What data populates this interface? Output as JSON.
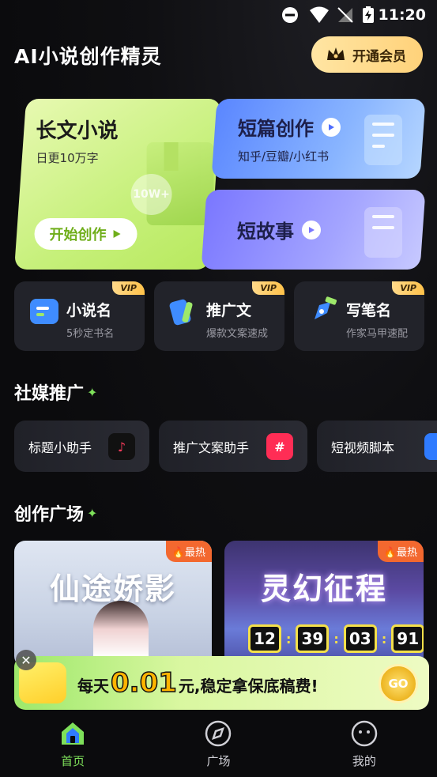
{
  "status": {
    "time": "11:20"
  },
  "header": {
    "title": "AI小说创作精灵",
    "vip_button": "开通会员"
  },
  "cards": {
    "long": {
      "title": "长文小说",
      "subtitle": "日更10万字",
      "badge": "10W+",
      "button": "开始创作"
    },
    "short": {
      "title": "短篇创作",
      "subtitle": "知乎/豆瓣/小红书"
    },
    "story": {
      "title": "短故事"
    }
  },
  "tools": [
    {
      "title": "小说名",
      "subtitle": "5秒定书名",
      "badge": "VIP"
    },
    {
      "title": "推广文",
      "subtitle": "爆款文案速成",
      "badge": "VIP"
    },
    {
      "title": "写笔名",
      "subtitle": "作家马甲速配",
      "badge": "VIP"
    }
  ],
  "social": {
    "title": "社媒推广",
    "items": [
      {
        "label": "标题小助手"
      },
      {
        "label": "推广文案助手"
      },
      {
        "label": "短视频脚本"
      }
    ]
  },
  "plaza": {
    "title": "创作广场",
    "items": [
      {
        "title": "仙途娇影",
        "tag": "最热"
      },
      {
        "title": "灵幻征程",
        "tag": "最热",
        "timer": [
          "12",
          "39",
          "03",
          "91"
        ]
      }
    ]
  },
  "banner": {
    "prefix": "每天",
    "amount": "0.01",
    "suffix": "元,稳定拿保底稿费!",
    "go": "GO"
  },
  "nav": [
    {
      "label": "首页"
    },
    {
      "label": "广场"
    },
    {
      "label": "我的"
    }
  ],
  "colors": {
    "accent": "#7ee05a",
    "vip_gold": "#ffd27a",
    "hot": "#f3682f"
  }
}
